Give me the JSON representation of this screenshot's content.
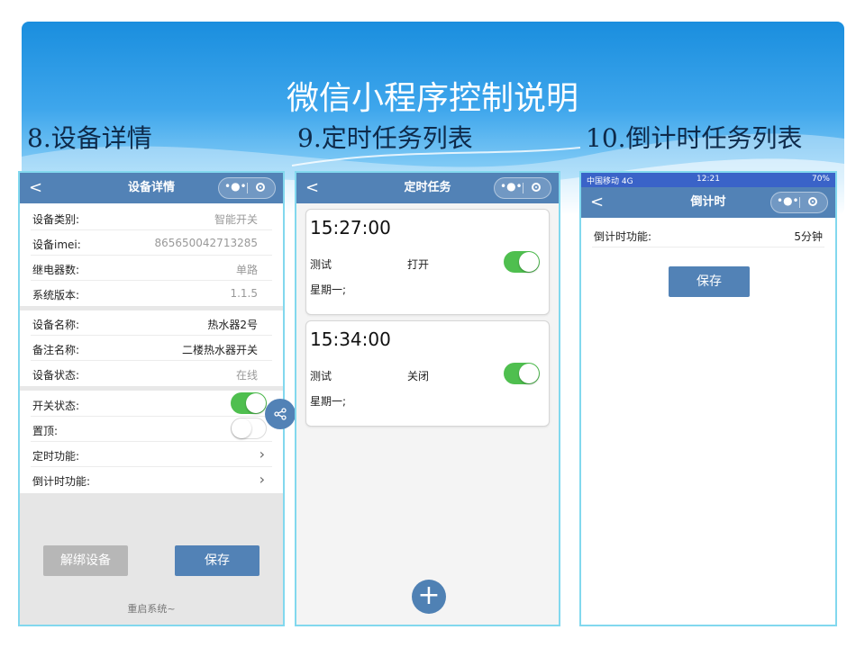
{
  "slide": {
    "title": "微信小程序控制说明",
    "sections": [
      "8.设备详情",
      "9.定时任务列表",
      "10.倒计时任务列表"
    ]
  },
  "colors": {
    "navbar": "#5282b6",
    "toggle_on": "#4fbf4f",
    "accent_button": "#5282b6",
    "disabled_button": "#b7b7b7",
    "frame": "#82d8ee"
  },
  "icons": {
    "back": "chevron-left-icon",
    "more": "more-dots-icon",
    "close": "target-circle-icon",
    "share": "share-icon",
    "add": "plus-icon",
    "arrow": "chevron-right-icon"
  },
  "device_detail": {
    "nav_title": "设备详情",
    "back": "<",
    "rows_info": [
      {
        "label": "设备类别:",
        "value": "智能开关"
      },
      {
        "label": "设备imei:",
        "value": "865650042713285"
      },
      {
        "label": "继电器数:",
        "value": "单路"
      },
      {
        "label": "系统版本:",
        "value": "1.1.5"
      }
    ],
    "rows_name": [
      {
        "label": "设备名称:",
        "value": "热水器2号"
      },
      {
        "label": "备注名称:",
        "value": "二楼热水器开关"
      },
      {
        "label": "设备状态:",
        "value": "在线"
      }
    ],
    "switch_label": "开关状态:",
    "switch_on": true,
    "pin_label": "置顶:",
    "pin_on": false,
    "timer_label": "定时功能:",
    "countdown_label": "倒计时功能:",
    "chevron": "›",
    "unbind_button": "解绑设备",
    "save_button": "保存",
    "reboot_text": "重启系统~"
  },
  "timer_list": {
    "nav_title": "定时任务",
    "back": "<",
    "tasks": [
      {
        "time": "15:27:00",
        "name": "测试",
        "action": "打开",
        "days": "星期一;",
        "enabled": true
      },
      {
        "time": "15:34:00",
        "name": "测试",
        "action": "关闭",
        "days": "星期一;",
        "enabled": true
      }
    ],
    "add_button": "+"
  },
  "countdown": {
    "status_carrier": "中国移动 4G",
    "status_time": "12:21",
    "status_battery": "70%",
    "nav_title": "倒计时",
    "back": "<",
    "label": "倒计时功能:",
    "value": "5分钟",
    "save_button": "保存"
  }
}
